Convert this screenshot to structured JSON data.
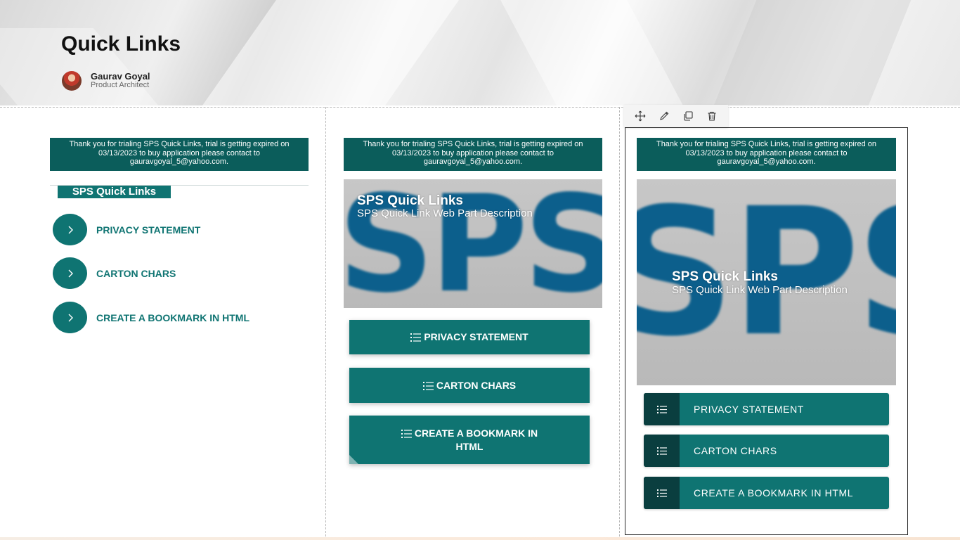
{
  "header": {
    "title": "Quick Links",
    "author_name": "Gaurav Goyal",
    "author_role": "Product Architect"
  },
  "trial_banner": "Thank you for trialing SPS Quick Links, trial is getting expired on 03/13/2023 to buy application please contact to gauravgoyal_5@yahoo.com.",
  "column1": {
    "title": "SPS Quick Links",
    "items": [
      {
        "label": "PRIVACY STATEMENT"
      },
      {
        "label": "CARTON CHARS"
      },
      {
        "label": "CREATE A BOOKMARK IN HTML"
      }
    ]
  },
  "column2": {
    "image_text": "SPS",
    "image_title": "SPS Quick Links",
    "image_desc": "SPS Quick Link Web Part Description",
    "items": [
      {
        "label": "PRIVACY STATEMENT"
      },
      {
        "label": "CARTON CHARS"
      },
      {
        "label": "CREATE A BOOKMARK IN HTML"
      }
    ]
  },
  "column3": {
    "image_text": "SPS",
    "image_title": "SPS Quick Links",
    "image_desc": "SPS Quick Link Web Part Description",
    "items": [
      {
        "label": "PRIVACY STATEMENT"
      },
      {
        "label": "CARTON CHARS"
      },
      {
        "label": "CREATE A BOOKMARK IN HTML"
      }
    ]
  },
  "toolbar": {
    "icons": [
      "move-icon",
      "edit-icon",
      "duplicate-icon",
      "delete-icon"
    ]
  },
  "colors": {
    "accent": "#0f7472",
    "banner": "#0b5d5b",
    "dark_icon_bg": "#0a3e3f"
  }
}
